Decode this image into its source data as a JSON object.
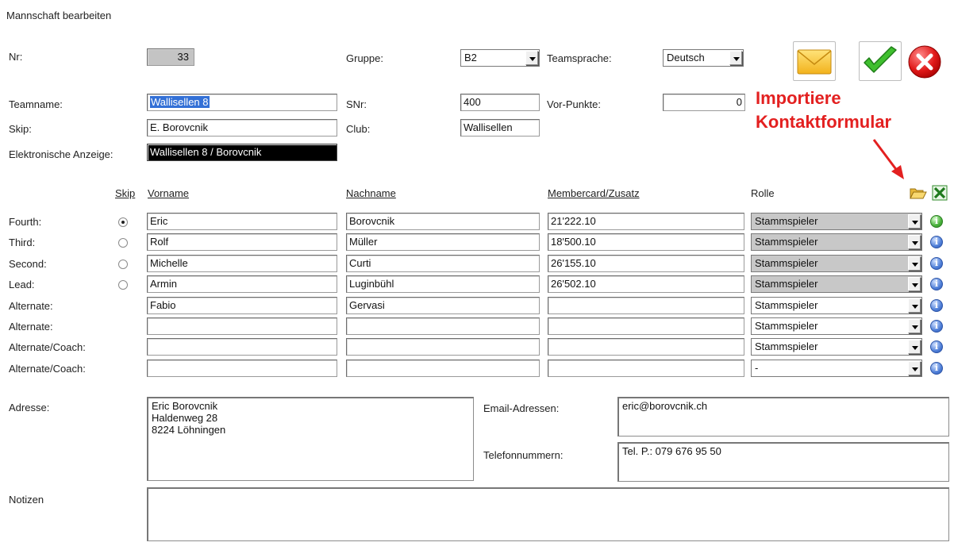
{
  "window": {
    "title": "Mannschaft bearbeiten"
  },
  "header": {
    "nr_label": "Nr:",
    "nr_value": "33",
    "gruppe_label": "Gruppe:",
    "gruppe_value": "B2",
    "teamsprache_label": "Teamsprache:",
    "teamsprache_value": "Deutsch",
    "teamname_label": "Teamname:",
    "teamname_value": "Wallisellen 8",
    "snr_label": "SNr:",
    "snr_value": "400",
    "vorpunkte_label": "Vor-Punkte:",
    "vorpunkte_value": "0",
    "skip_label": "Skip:",
    "skip_value": "E. Borovcnik",
    "club_label": "Club:",
    "club_value": "Wallisellen",
    "anzeige_label": "Elektronische Anzeige:",
    "anzeige_value": "Wallisellen 8 / Borovcnik"
  },
  "annotation": {
    "line1": "Importiere",
    "line2": "Kontaktformular",
    "color": "#e32020"
  },
  "table": {
    "headers": {
      "skip": "Skip",
      "vorname": "Vorname",
      "nachname": "Nachname",
      "membercard": "Membercard/Zusatz",
      "rolle": "Rolle"
    },
    "rows": [
      {
        "position": "Fourth:",
        "skip_selected": true,
        "vorname": "Eric",
        "nachname": "Borovcnik",
        "membercard": "21'222.10",
        "rolle": "Stammspieler",
        "status": "green"
      },
      {
        "position": "Third:",
        "skip_selected": false,
        "vorname": "Rolf",
        "nachname": "Müller",
        "membercard": "18'500.10",
        "rolle": "Stammspieler",
        "status": "blue"
      },
      {
        "position": "Second:",
        "skip_selected": false,
        "vorname": "Michelle",
        "nachname": "Curti",
        "membercard": "26'155.10",
        "rolle": "Stammspieler",
        "status": "blue"
      },
      {
        "position": "Lead:",
        "skip_selected": false,
        "vorname": "Armin",
        "nachname": "Luginbühl",
        "membercard": "26'502.10",
        "rolle": "Stammspieler",
        "status": "blue"
      },
      {
        "position": "Alternate:",
        "vorname": "Fabio",
        "nachname": "Gervasi",
        "membercard": "",
        "rolle": "Stammspieler",
        "status": "blue"
      },
      {
        "position": "Alternate:",
        "vorname": "",
        "nachname": "",
        "membercard": "",
        "rolle": "Stammspieler",
        "status": "blue"
      },
      {
        "position": "Alternate/Coach:",
        "vorname": "",
        "nachname": "",
        "membercard": "",
        "rolle": "Stammspieler",
        "status": "blue"
      },
      {
        "position": "Alternate/Coach:",
        "vorname": "",
        "nachname": "",
        "membercard": "",
        "rolle": "-",
        "status": "blue"
      }
    ]
  },
  "contact": {
    "adresse_label": "Adresse:",
    "adresse_value": "Eric Borovcnik\nHaldenweg 28\n8224 Löhningen",
    "email_label": "Email-Adressen:",
    "email_value": "eric@borovcnik.ch",
    "telefon_label": "Telefonnummern:",
    "telefon_value": "Tel. P.: 079 676 95 50",
    "notizen_label": "Notizen",
    "notizen_value": ""
  },
  "icons": {
    "mail": "envelope-icon",
    "ok": "checkmark-icon",
    "cancel": "close-icon",
    "import": "folder-open-icon",
    "excel": "excel-icon",
    "info": "info-icon"
  },
  "colors": {
    "info_blue": "#4f7fd8",
    "info_green": "#48b03a",
    "selection": "#3370d6"
  }
}
